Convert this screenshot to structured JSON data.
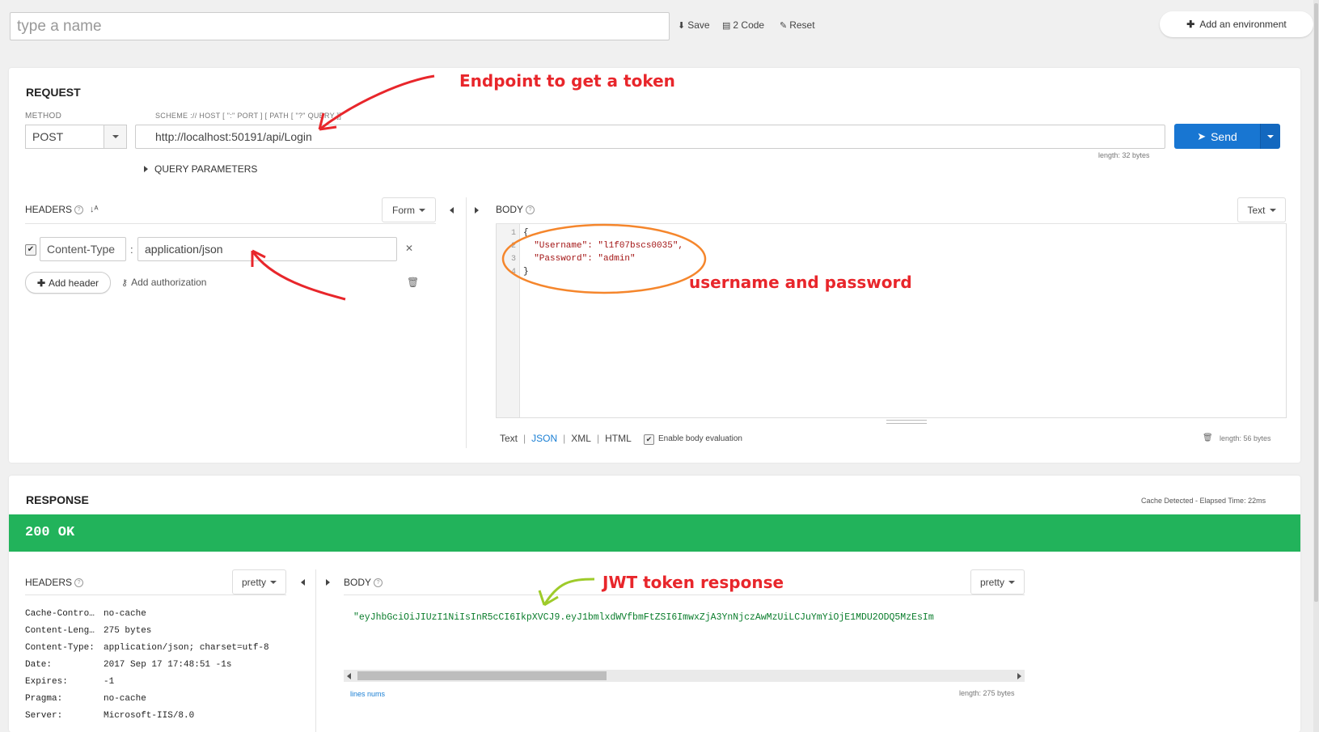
{
  "top": {
    "name_placeholder": "type a name",
    "save_label": "Save",
    "code_label": "2 Code",
    "reset_label": "Reset",
    "add_env_label": "Add an environment"
  },
  "request": {
    "title": "REQUEST",
    "method_label": "METHOD",
    "method_value": "POST",
    "url_label": "SCHEME :// HOST [ \":\" PORT ] [ PATH [ \"?\" QUERY ]]",
    "url_value": "http://localhost:50191/api/Login",
    "url_length": "length: 32 bytes",
    "send_label": "Send",
    "query_params_label": "QUERY PARAMETERS",
    "headers_label": "HEADERS",
    "form_label": "Form",
    "header_name": "Content-Type",
    "header_value": "application/json",
    "add_header_label": "Add header",
    "add_auth_label": "Add authorization",
    "body_label": "BODY",
    "body_type_label": "Text",
    "body_lines": [
      "{",
      "  \"Username\": \"l1f07bscs0035\",",
      "  \"Password\": \"admin\"",
      "}"
    ],
    "line_numbers": [
      "1",
      "2",
      "3",
      "4"
    ],
    "format_tabs": [
      "Text",
      "JSON",
      "XML",
      "HTML"
    ],
    "active_format": "JSON",
    "enable_eval_label": "Enable body evaluation",
    "body_length": "length: 56 bytes"
  },
  "response": {
    "title": "RESPONSE",
    "cache_info": "Cache Detected - Elapsed Time: 22ms",
    "status": "200 OK",
    "status_color": "#22b35b",
    "headers_label": "HEADERS",
    "pretty_label": "pretty",
    "body_label": "BODY",
    "headers": [
      {
        "name": "Cache-Contro…",
        "value": "no-cache"
      },
      {
        "name": "Content-Leng…",
        "value": "275 bytes"
      },
      {
        "name": "Content-Type:",
        "value": "application/json; charset=utf-8"
      },
      {
        "name": "Date:",
        "value": "2017 Sep 17 17:48:51 -1s"
      },
      {
        "name": "Expires:",
        "value": "-1"
      },
      {
        "name": "Pragma:",
        "value": "no-cache"
      },
      {
        "name": "Server:",
        "value": "Microsoft-IIS/8.0"
      }
    ],
    "body_text": "\"eyJhbGciOiJIUzI1NiIsInR5cCI6IkpXVCJ9.eyJ1bmlxdWVfbmFtZSI6ImwxZjA3YnNjczAwMzUiLCJuYmYiOjE1MDU2ODQ5MzEsIm",
    "lines_nums_label": "lines nums",
    "body_length": "length: 275 bytes"
  },
  "annotations": {
    "endpoint": "Endpoint to get a token",
    "credentials": "username and password",
    "jwt": "JWT token response"
  }
}
